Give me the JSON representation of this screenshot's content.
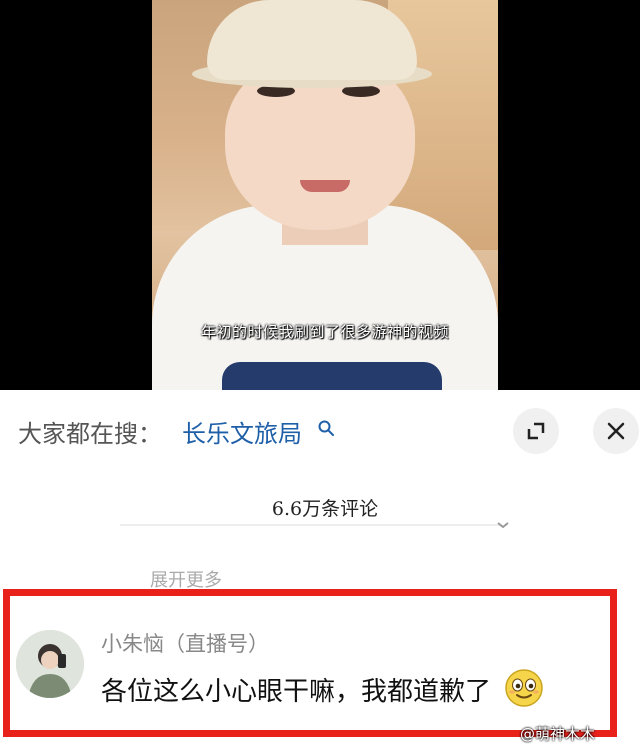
{
  "video": {
    "subtitle": "年初的时候我刷到了很多游神的视频"
  },
  "search": {
    "prefix": "大家都在搜：",
    "term": "长乐文旅局",
    "icon": "search-icon"
  },
  "controls": {
    "expand_icon": "expand-icon",
    "close_icon": "close-icon"
  },
  "comments": {
    "count_label": "6.6万条评论",
    "expand_more": "展开更多",
    "highlighted": {
      "author": "小朱恼（直播号）",
      "text": "各位这么小心眼干嘛，我都道歉了",
      "emoji": "smiling-face-emoji"
    }
  },
  "watermark": "@萌神木木",
  "colors": {
    "highlight_border": "#e8211b",
    "search_term": "#1e5fa8"
  }
}
